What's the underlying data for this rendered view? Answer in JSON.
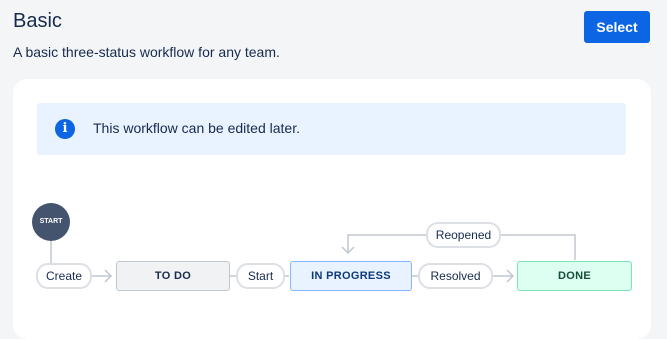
{
  "header": {
    "title": "Basic",
    "description": "A basic three-status workflow for any team.",
    "select_label": "Select"
  },
  "info": {
    "icon": "info-icon",
    "icon_glyph": "i",
    "text": "This workflow can be edited later."
  },
  "workflow": {
    "start_label": "START",
    "transitions": {
      "create": "Create",
      "start": "Start",
      "resolved": "Resolved",
      "reopened": "Reopened"
    },
    "statuses": {
      "todo": "TO DO",
      "in_progress": "IN PROGRESS",
      "done": "DONE"
    }
  },
  "colors": {
    "primary": "#0c66e4",
    "todo_bg": "#f1f2f4",
    "in_progress_bg": "#e9f2ff",
    "done_bg": "#dcfff1"
  }
}
